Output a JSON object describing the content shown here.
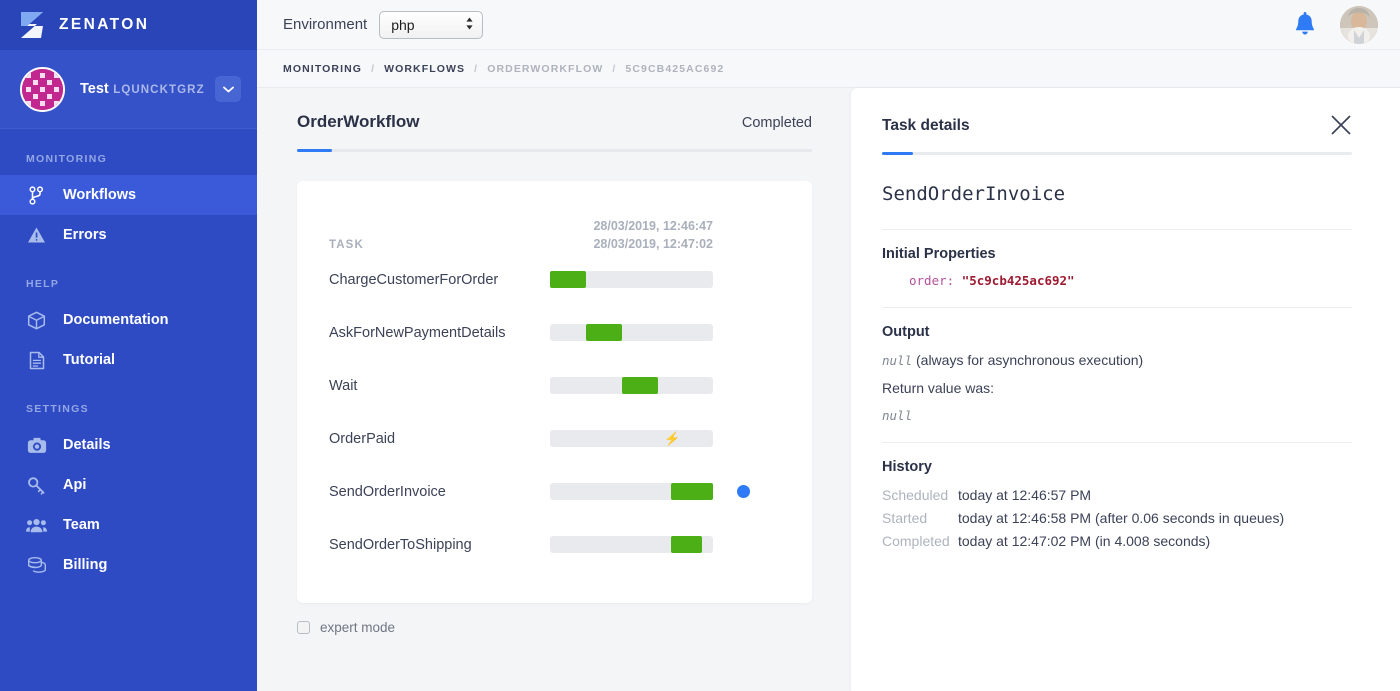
{
  "sidebar": {
    "brand": {
      "name": "ZENATON",
      "logo_icon": "zenaton-z-logo"
    },
    "org": {
      "name": "Test",
      "id": "LQUNCKTGRZ",
      "caret_icon": "chevron-down-icon",
      "avatar_icon": "identicon-avatar"
    },
    "groups": [
      {
        "title": "MONITORING",
        "items": [
          {
            "label": "Workflows",
            "icon": "workflow-branch-icon",
            "active": true
          },
          {
            "label": "Errors",
            "icon": "warning-triangle-icon",
            "active": false
          }
        ]
      },
      {
        "title": "HELP",
        "items": [
          {
            "label": "Documentation",
            "icon": "box-package-icon",
            "active": false
          },
          {
            "label": "Tutorial",
            "icon": "document-lines-icon",
            "active": false
          }
        ]
      },
      {
        "title": "SETTINGS",
        "items": [
          {
            "label": "Details",
            "icon": "camera-icon",
            "active": false
          },
          {
            "label": "Api",
            "icon": "key-icon",
            "active": false
          },
          {
            "label": "Team",
            "icon": "people-group-icon",
            "active": false
          },
          {
            "label": "Billing",
            "icon": "coins-stack-icon",
            "active": false
          }
        ]
      }
    ]
  },
  "topbar": {
    "environment_label": "Environment",
    "environment_value": "php",
    "environment_options": [
      "php"
    ],
    "bell_icon": "notification-bell-icon",
    "avatar_icon": "user-avatar"
  },
  "breadcrumb": {
    "separator": "/",
    "items": [
      {
        "label": "MONITORING",
        "muted": false
      },
      {
        "label": "WORKFLOWS",
        "muted": false
      },
      {
        "label": "ORDERWORKFLOW",
        "muted": true
      },
      {
        "label": "5C9CB425AC692",
        "muted": true
      }
    ]
  },
  "workflow": {
    "title": "OrderWorkflow",
    "status": "Completed",
    "column_task": "TASK",
    "date_start": "28/03/2019, 12:46:47",
    "date_end": "28/03/2019, 12:47:02",
    "expert_mode_label": "expert mode",
    "expert_mode_checked": false,
    "colors": {
      "bar": "#4caf16",
      "track": "#e8eaee",
      "dot": "#2f7bf5",
      "accent": "#2f7bf5"
    }
  },
  "chart_data": {
    "type": "bar",
    "title": "OrderWorkflow task timeline",
    "xlabel": "",
    "ylabel": "",
    "x_range": [
      "28/03/2019, 12:46:47",
      "28/03/2019, 12:47:02"
    ],
    "bar_color": "#4caf16",
    "track_color": "#e8eaee",
    "tasks": [
      {
        "name": "ChargeCustomerForOrder",
        "start_pct": 0,
        "end_pct": 22,
        "event": false,
        "selected": false
      },
      {
        "name": "AskForNewPaymentDetails",
        "start_pct": 22,
        "end_pct": 44,
        "event": false,
        "selected": false
      },
      {
        "name": "Wait",
        "start_pct": 44,
        "end_pct": 66,
        "event": false,
        "selected": false
      },
      {
        "name": "OrderPaid",
        "start_pct": 70,
        "end_pct": 70,
        "event": true,
        "selected": false
      },
      {
        "name": "SendOrderInvoice",
        "start_pct": 74,
        "end_pct": 100,
        "event": false,
        "selected": true
      },
      {
        "name": "SendOrderToShipping",
        "start_pct": 74,
        "end_pct": 93,
        "event": false,
        "selected": false
      }
    ]
  },
  "details": {
    "panel_title": "Task details",
    "close_icon": "close-x-icon",
    "task_name": "SendOrderInvoice",
    "initial_properties": {
      "title": "Initial Properties",
      "key": "order:",
      "value": "\"5c9cb425ac692\""
    },
    "output": {
      "title": "Output",
      "null_token": "null",
      "note": "(always for asynchronous execution)",
      "return_label": "Return value was:",
      "return_value": "null"
    },
    "history": {
      "title": "History",
      "rows": [
        {
          "label": "Scheduled",
          "time": "today at 12:46:57 PM",
          "extra": ""
        },
        {
          "label": "Started",
          "time": "today at 12:46:58 PM",
          "extra": "(after 0.06 seconds in queues)"
        },
        {
          "label": "Completed",
          "time": "today at 12:47:02 PM",
          "extra": "(in 4.008 seconds)"
        }
      ]
    }
  }
}
